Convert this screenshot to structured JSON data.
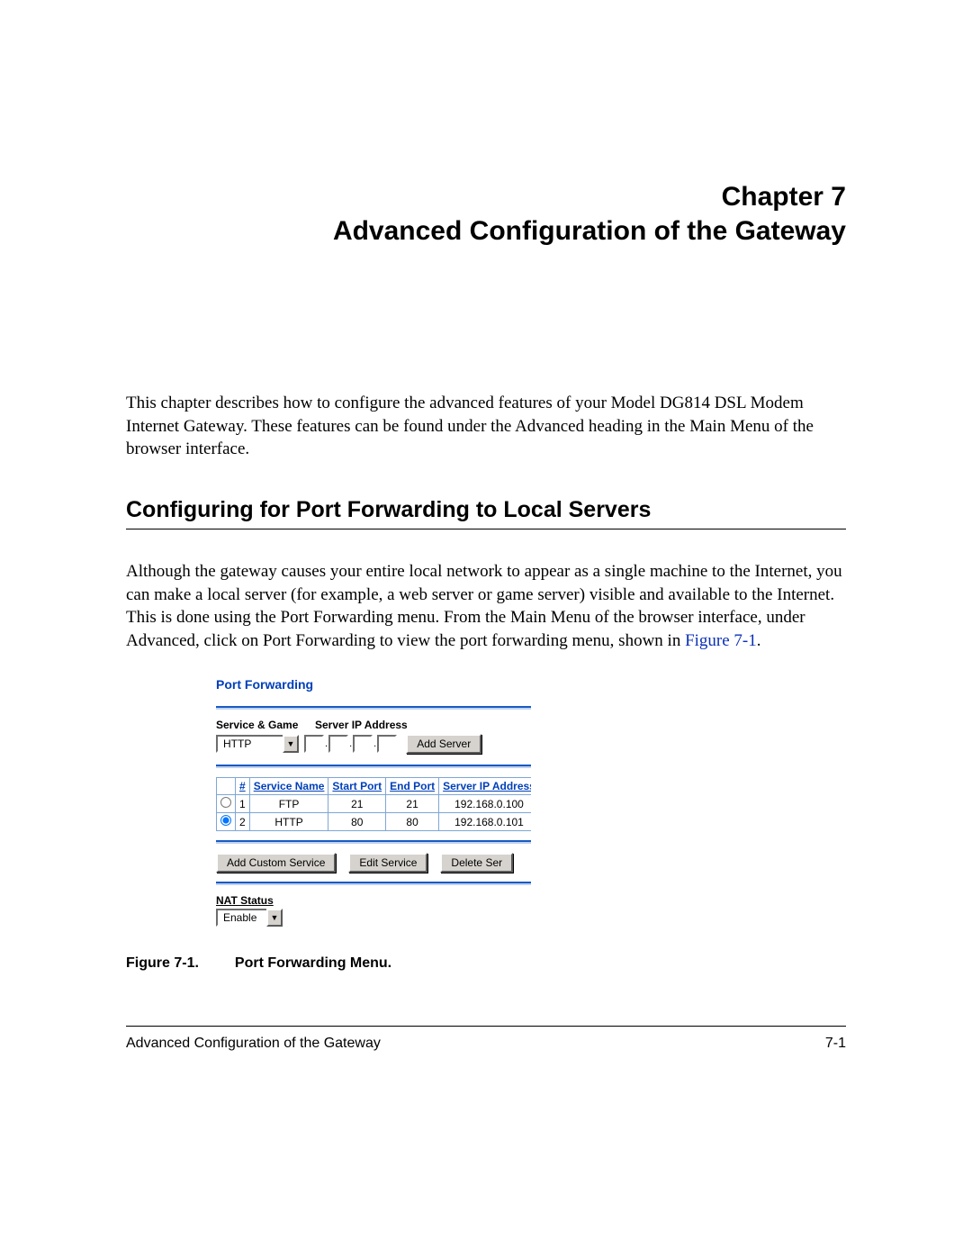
{
  "chapter": {
    "number_label": "Chapter 7",
    "title": "Advanced Configuration of the Gateway"
  },
  "intro": "This chapter describes how to configure the advanced features of your Model DG814 DSL Modem Internet Gateway. These features can be found under the Advanced heading in the Main Menu of the browser interface.",
  "section1": {
    "heading": "Configuring for Port Forwarding to Local Servers",
    "body_pre": "Although the gateway causes your entire local network to appear as a single machine to the Internet, you can make a local server (for example, a web server or game server) visible and available to the Internet. This is done using the Port Forwarding menu. From the Main Menu of the browser interface, under Advanced, click on Port Forwarding to view the port forwarding menu, shown in ",
    "body_xref": "Figure 7-1",
    "body_post": "."
  },
  "figure": {
    "panel_title": "Port Forwarding",
    "header_service": "Service & Game",
    "header_ip": "Server IP Address",
    "service_select_value": "HTTP",
    "add_server_btn": "Add Server",
    "table": {
      "headers": {
        "num": "#",
        "svc": "Service Name",
        "start": "Start Port",
        "end": "End Port",
        "ip": "Server IP Address"
      },
      "rows": [
        {
          "selected": false,
          "num": "1",
          "svc": "FTP",
          "start": "21",
          "end": "21",
          "ip": "192.168.0.100"
        },
        {
          "selected": true,
          "num": "2",
          "svc": "HTTP",
          "start": "80",
          "end": "80",
          "ip": "192.168.0.101"
        }
      ]
    },
    "buttons": {
      "add_custom": "Add Custom Service",
      "edit": "Edit Service",
      "delete": "Delete Ser"
    },
    "nat_label": "NAT Status",
    "nat_value": "Enable",
    "caption_label": "Figure 7-1.",
    "caption_text": "Port Forwarding Menu."
  },
  "footer": {
    "left": "Advanced Configuration of the Gateway",
    "right": "7-1"
  }
}
